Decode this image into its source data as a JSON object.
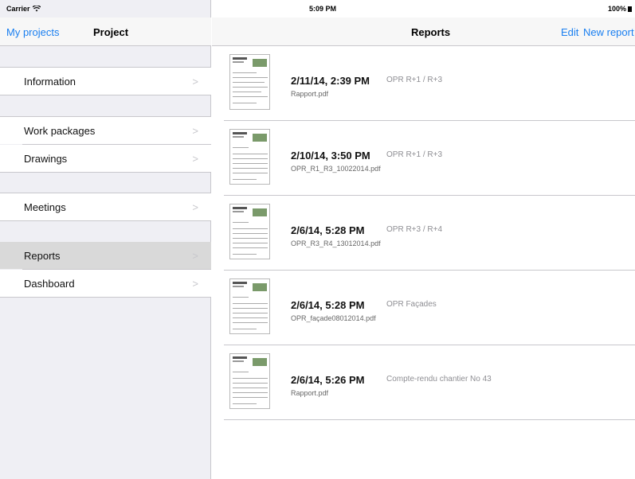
{
  "status": {
    "carrier": "Carrier",
    "time": "5:09 PM",
    "battery": "100%"
  },
  "sidebar": {
    "back_label": "My projects",
    "title": "Project",
    "items": [
      {
        "label": "Information"
      },
      {
        "label": "Work packages"
      },
      {
        "label": "Drawings"
      },
      {
        "label": "Meetings"
      },
      {
        "label": "Reports",
        "selected": true
      },
      {
        "label": "Dashboard"
      }
    ],
    "chevron": ">"
  },
  "main": {
    "title": "Reports",
    "edit_label": "Edit",
    "new_label": "New report",
    "reports": [
      {
        "date": "2/11/14, 2:39 PM",
        "subject": "OPR R+1 / R+3",
        "file": "Rapport.pdf"
      },
      {
        "date": "2/10/14, 3:50 PM",
        "subject": "OPR R+1 / R+3",
        "file": "OPR_R1_R3_10022014.pdf"
      },
      {
        "date": "2/6/14, 5:28 PM",
        "subject": "OPR R+3 / R+4",
        "file": "OPR_R3_R4_13012014.pdf"
      },
      {
        "date": "2/6/14, 5:28 PM",
        "subject": "OPR Façades",
        "file": "OPR_façade08012014.pdf"
      },
      {
        "date": "2/6/14, 5:26 PM",
        "subject": "Compte-rendu chantier No 43",
        "file": "Rapport.pdf"
      }
    ]
  },
  "colors": {
    "accent": "#1a7ff0",
    "selected_row": "#d9d9d9",
    "sidebar_bg": "#efeff4"
  }
}
